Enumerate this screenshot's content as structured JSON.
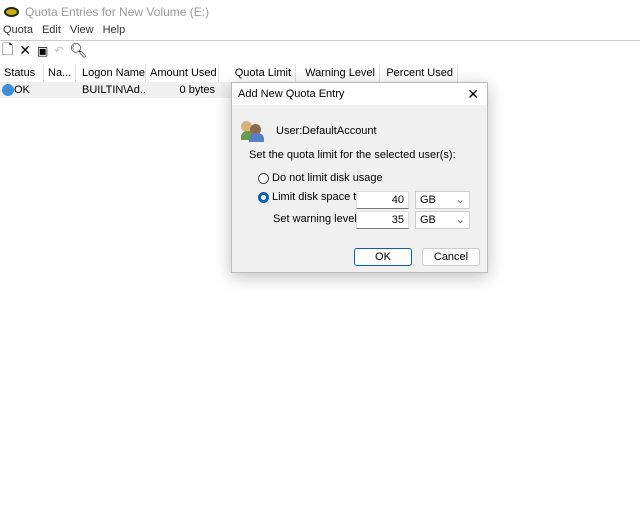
{
  "window": {
    "title": "Quota Entries for New Volume (E:)"
  },
  "menu": [
    "Quota",
    "Edit",
    "View",
    "Help"
  ],
  "toolbar": {
    "icons": [
      "new-icon",
      "delete-icon",
      "properties-icon",
      "undo-icon",
      "find-icon"
    ]
  },
  "table": {
    "columns": [
      "Status",
      "Na...",
      "Logon Name",
      "Amount Used",
      "Quota Limit",
      "Warning Level",
      "Percent Used"
    ],
    "rows": [
      {
        "status": "OK",
        "name": "",
        "logon": "BUILTIN\\Ad...",
        "amount": "0 bytes"
      }
    ]
  },
  "dialog": {
    "title": "Add New Quota Entry",
    "user_label": "User:",
    "user_value": "DefaultAccount",
    "instruction": "Set the quota limit for the selected user(s):",
    "option_no_limit": "Do not limit disk usage",
    "option_limit": "Limit disk space to",
    "selected_option": "limit",
    "limit_value": "40",
    "limit_unit": "GB",
    "warning_label": "Set warning level to",
    "warning_value": "35",
    "warning_unit": "GB",
    "ok": "OK",
    "cancel": "Cancel"
  }
}
